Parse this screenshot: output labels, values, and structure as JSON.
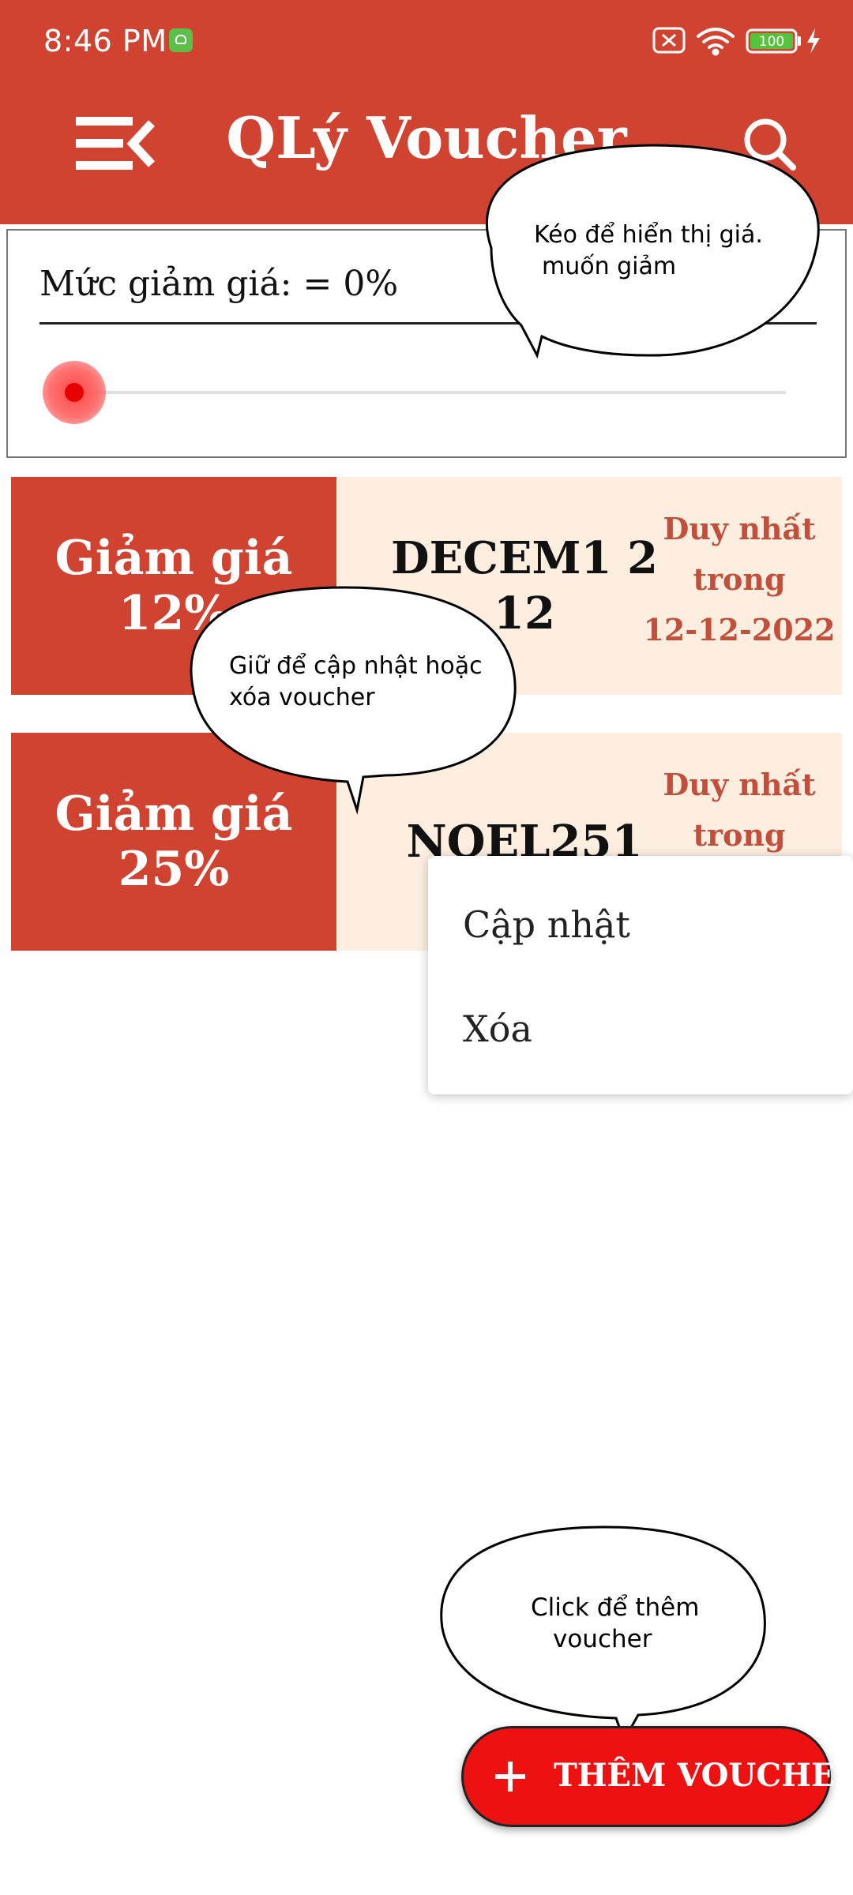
{
  "status_bar": {
    "time": "8:46 PM",
    "battery": "100"
  },
  "header": {
    "title": "QLý Voucher",
    "menu_icon": "menu-collapse-icon",
    "search_icon": "search-icon"
  },
  "filter": {
    "label": "Mức giảm giá: = 0%",
    "slider_value_percent": 0,
    "tooltip": [
      "Kéo để hiển thị giá.",
      "muốn giảm"
    ]
  },
  "vouchers": [
    {
      "discount_line1": "Giảm giá",
      "discount_line2": "12%",
      "code": "DECEM1 212",
      "expiry_line1": "Duy nhất",
      "expiry_line2": "trong",
      "expiry_line3": "12-12-2022"
    },
    {
      "discount_line1": "Giảm giá",
      "discount_line2": "25%",
      "code": "NOEL251",
      "expiry_line1": "Duy nhất",
      "expiry_line2": "trong"
    }
  ],
  "voucher_tooltip": [
    "Giữ để cập nhật hoặc",
    "xóa voucher"
  ],
  "context_menu": {
    "update": "Cập nhật",
    "delete": "Xóa"
  },
  "fab": {
    "label": "THÊM VOUCHER",
    "tooltip": [
      "Click để thêm",
      "voucher"
    ]
  },
  "colors": {
    "primary": "#d14331",
    "voucher_bg": "#fdeee0",
    "fab": "#ee1111",
    "expiry_text": "#c24f3c"
  }
}
